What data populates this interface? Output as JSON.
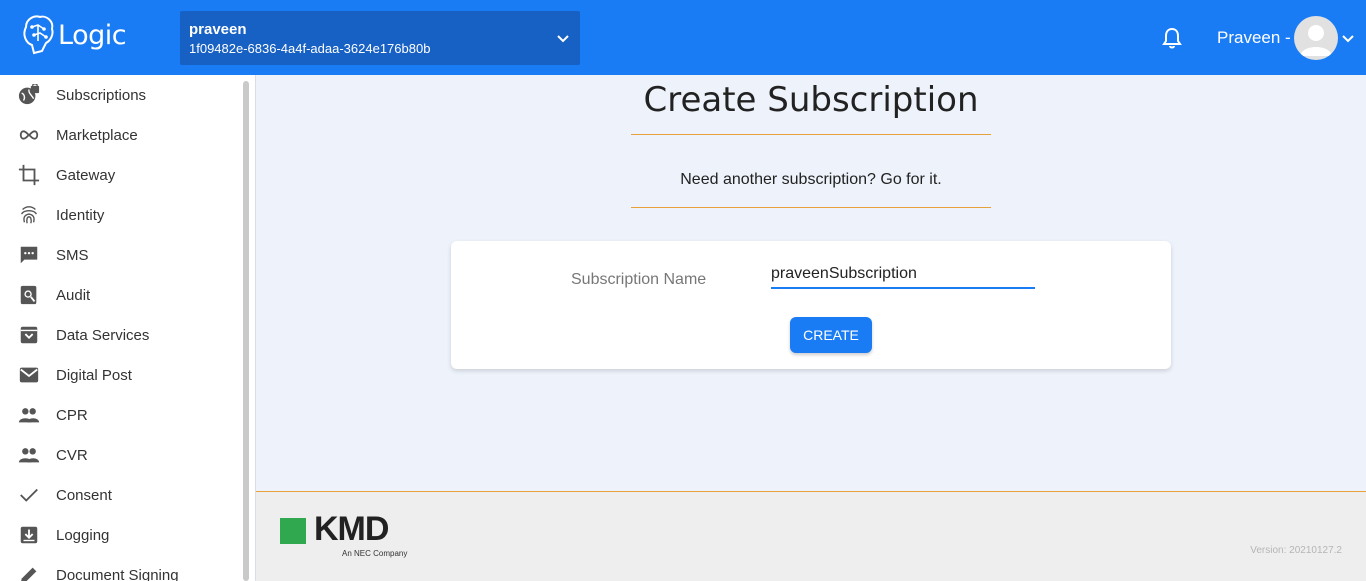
{
  "header": {
    "app_name": "Logic",
    "tenant": {
      "name": "praveen",
      "id": "1f09482e-6836-4a4f-adaa-3624e176b80b"
    },
    "user": {
      "name": "Praveen -"
    }
  },
  "sidebar": {
    "items": [
      {
        "label": "Subscriptions",
        "icon": "globe-lock-icon"
      },
      {
        "label": "Marketplace",
        "icon": "infinity-icon"
      },
      {
        "label": "Gateway",
        "icon": "crop-icon"
      },
      {
        "label": "Identity",
        "icon": "fingerprint-icon"
      },
      {
        "label": "SMS",
        "icon": "sms-icon"
      },
      {
        "label": "Audit",
        "icon": "audit-search-icon"
      },
      {
        "label": "Data Services",
        "icon": "archive-icon"
      },
      {
        "label": "Digital Post",
        "icon": "mail-icon"
      },
      {
        "label": "CPR",
        "icon": "people-icon"
      },
      {
        "label": "CVR",
        "icon": "people-icon"
      },
      {
        "label": "Consent",
        "icon": "checkmark-icon"
      },
      {
        "label": "Logging",
        "icon": "download-box-icon"
      },
      {
        "label": "Document Signing",
        "icon": "pen-icon"
      }
    ]
  },
  "main": {
    "title": "Create Subscription",
    "subtitle": "Need another subscription? Go for it.",
    "form": {
      "name_label": "Subscription Name",
      "name_value": "praveenSubscription",
      "create_label": "CREATE"
    }
  },
  "footer": {
    "logo_text": "KMD",
    "logo_sub": "An NEC Company",
    "version": "Version: 20210127.2"
  },
  "colors": {
    "primary": "#1a7cf4",
    "accent_rule": "#e8a13a",
    "brand_green": "#2fa84f"
  }
}
